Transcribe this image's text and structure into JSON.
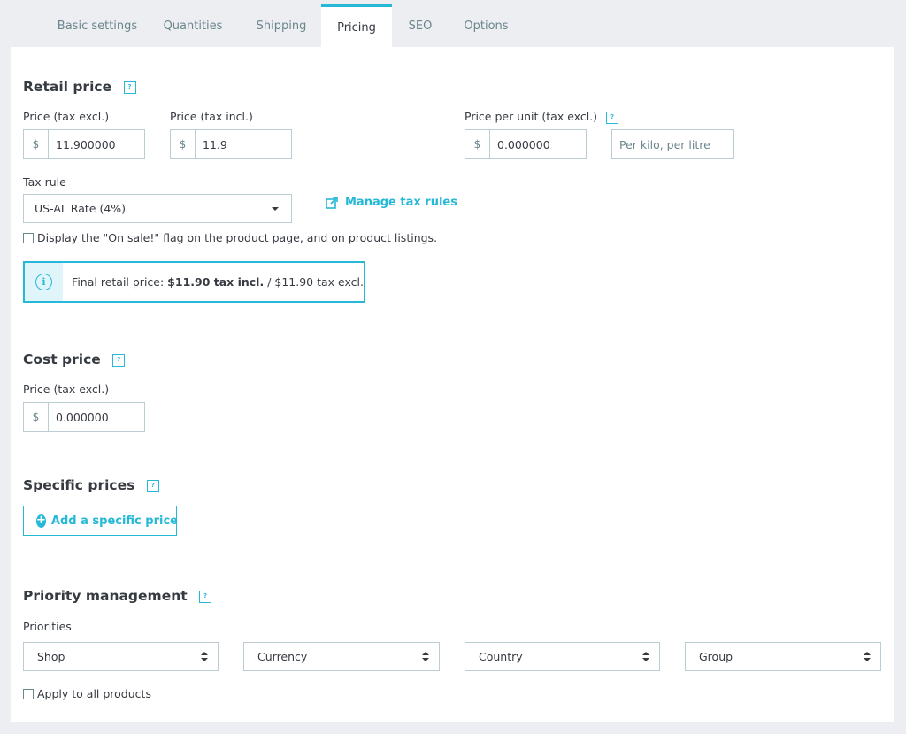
{
  "tabs": [
    {
      "label": "Basic settings"
    },
    {
      "label": "Quantities"
    },
    {
      "label": "Shipping"
    },
    {
      "label": "Pricing"
    },
    {
      "label": "SEO"
    },
    {
      "label": "Options"
    }
  ],
  "retail": {
    "title": "Retail price",
    "help": "?",
    "price_excl_label": "Price (tax excl.)",
    "price_excl_currency": "$",
    "price_excl_value": "11.900000",
    "price_incl_label": "Price (tax incl.)",
    "price_incl_currency": "$",
    "price_incl_value": "11.9",
    "unit_label": "Price per unit (tax excl.)",
    "unit_currency": "$",
    "unit_value": "0.000000",
    "unit_placeholder": "Per kilo, per litre",
    "tax_rule_label": "Tax rule",
    "tax_rule_value": "US-AL Rate (4%)",
    "manage_tax_label": "Manage tax rules",
    "on_sale_label": "Display the \"On sale!\" flag on the product page, and on product listings.",
    "final_prefix": "Final retail price: ",
    "final_incl": "$11.90 tax incl.",
    "final_suffix": " / $11.90 tax excl.",
    "info_icon": "i"
  },
  "cost": {
    "title": "Cost price",
    "help": "?",
    "price_label": "Price (tax excl.)",
    "currency": "$",
    "value": "0.000000"
  },
  "specific": {
    "title": "Specific prices",
    "help": "?",
    "add_label": "Add a specific price",
    "plus": "+"
  },
  "priority": {
    "title": "Priority management",
    "help": "?",
    "priorities_label": "Priorities",
    "selects": [
      {
        "value": "Shop"
      },
      {
        "value": "Currency"
      },
      {
        "value": "Country"
      },
      {
        "value": "Group"
      }
    ],
    "apply_all_label": "Apply to all products"
  },
  "colors": {
    "accent": "#25b9d7",
    "text": "#363a41",
    "muted": "#6c868e",
    "border": "#bbcdd2"
  }
}
